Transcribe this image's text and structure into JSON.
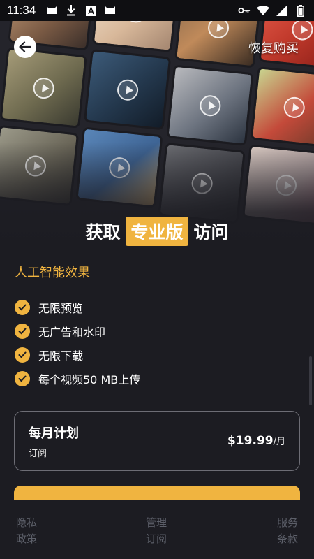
{
  "status_bar": {
    "time": "11:34",
    "left_icons": [
      "cat-icon",
      "download-icon",
      "font-a-icon",
      "cat-icon"
    ],
    "right_icons": [
      "key-icon",
      "wifi-icon",
      "signal-icon",
      "battery-icon"
    ]
  },
  "header": {
    "restore_label": "恢复购买"
  },
  "headline": {
    "before": "获取",
    "highlight": "专业版",
    "after": "访问"
  },
  "section_title": "人工智能效果",
  "features": [
    {
      "label": "无限预览"
    },
    {
      "label": "无广告和水印"
    },
    {
      "label": "无限下载"
    },
    {
      "label": "每个视频50 MB上传"
    }
  ],
  "plan": {
    "name": "每月计划",
    "subtitle": "订阅",
    "price": "$19.99",
    "per": "/月"
  },
  "footer": {
    "privacy_1": "隐私",
    "privacy_2": "政策",
    "manage_1": "管理",
    "manage_2": "订阅",
    "terms_1": "服务",
    "terms_2": "条款"
  },
  "colors": {
    "accent": "#f0b440",
    "background": "#1c1c22",
    "footer_text": "#5c5f69"
  }
}
